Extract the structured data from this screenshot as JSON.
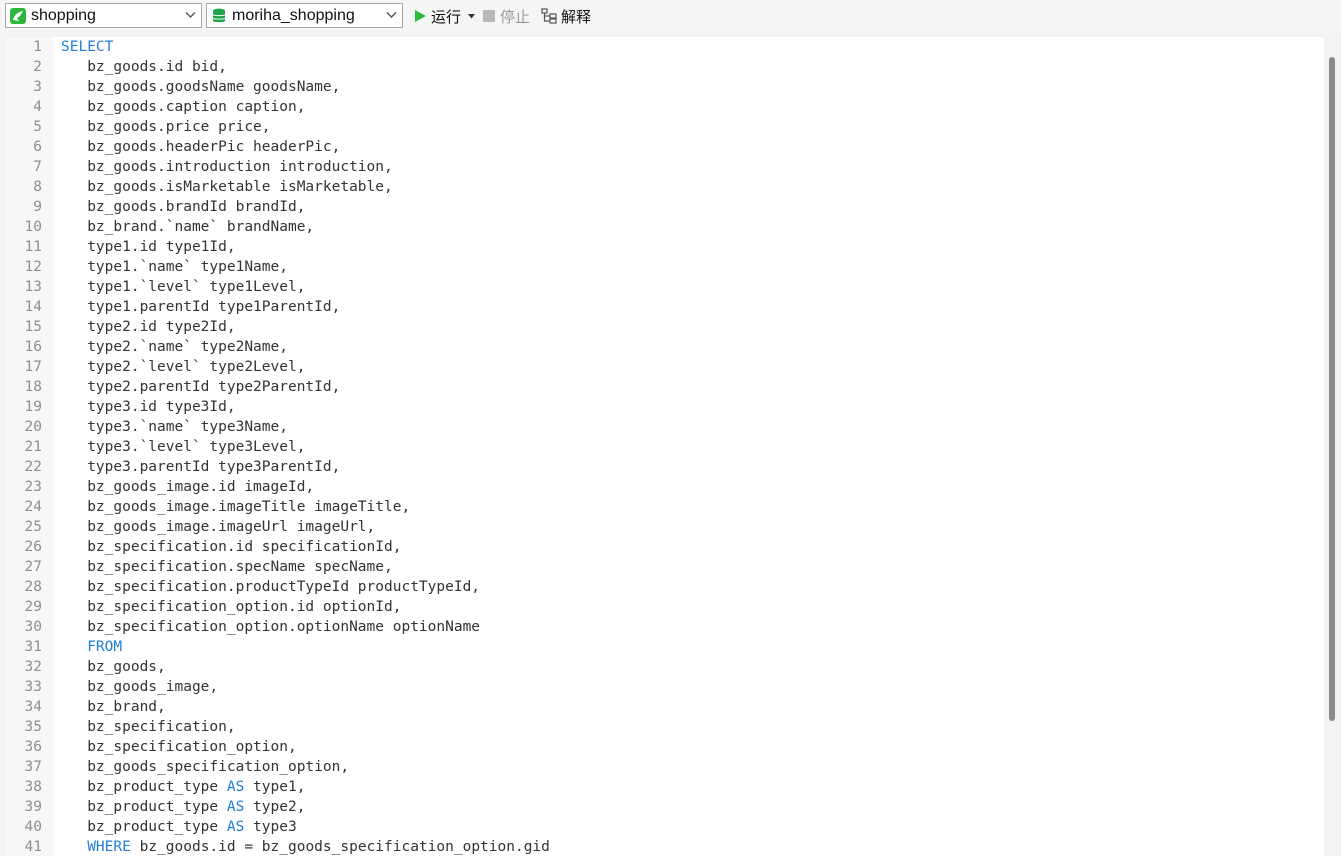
{
  "toolbar": {
    "connection": {
      "value": "shopping",
      "icon": "mysql-connection-icon"
    },
    "database": {
      "value": "moriha_shopping",
      "icon": "database-icon"
    },
    "run_label": "运行",
    "stop_label": "停止",
    "explain_label": "解释"
  },
  "colors": {
    "keyword": "#1f7fd8",
    "code_text": "#333333",
    "line_number": "#8e8e8e",
    "run_green": "#2db83d",
    "db_green": "#1fa34a"
  },
  "editor": {
    "language": "sql",
    "lines": [
      {
        "n": "1",
        "parts": [
          [
            "kw",
            "SELECT"
          ]
        ]
      },
      {
        "n": "2",
        "parts": [
          [
            "t",
            "   bz_goods.id bid,"
          ]
        ]
      },
      {
        "n": "3",
        "parts": [
          [
            "t",
            "   bz_goods.goodsName goodsName,"
          ]
        ]
      },
      {
        "n": "4",
        "parts": [
          [
            "t",
            "   bz_goods.caption caption,"
          ]
        ]
      },
      {
        "n": "5",
        "parts": [
          [
            "t",
            "   bz_goods.price price,"
          ]
        ]
      },
      {
        "n": "6",
        "parts": [
          [
            "t",
            "   bz_goods.headerPic headerPic,"
          ]
        ]
      },
      {
        "n": "7",
        "parts": [
          [
            "t",
            "   bz_goods.introduction introduction,"
          ]
        ]
      },
      {
        "n": "8",
        "parts": [
          [
            "t",
            "   bz_goods.isMarketable isMarketable,"
          ]
        ]
      },
      {
        "n": "9",
        "parts": [
          [
            "t",
            "   bz_goods.brandId brandId,"
          ]
        ]
      },
      {
        "n": "10",
        "parts": [
          [
            "t",
            "   bz_brand.`name` brandName,"
          ]
        ]
      },
      {
        "n": "11",
        "parts": [
          [
            "t",
            "   type1.id type1Id,"
          ]
        ]
      },
      {
        "n": "12",
        "parts": [
          [
            "t",
            "   type1.`name` type1Name,"
          ]
        ]
      },
      {
        "n": "13",
        "parts": [
          [
            "t",
            "   type1.`level` type1Level,"
          ]
        ]
      },
      {
        "n": "14",
        "parts": [
          [
            "t",
            "   type1.parentId type1ParentId,"
          ]
        ]
      },
      {
        "n": "15",
        "parts": [
          [
            "t",
            "   type2.id type2Id,"
          ]
        ]
      },
      {
        "n": "16",
        "parts": [
          [
            "t",
            "   type2.`name` type2Name,"
          ]
        ]
      },
      {
        "n": "17",
        "parts": [
          [
            "t",
            "   type2.`level` type2Level,"
          ]
        ]
      },
      {
        "n": "18",
        "parts": [
          [
            "t",
            "   type2.parentId type2ParentId,"
          ]
        ]
      },
      {
        "n": "19",
        "parts": [
          [
            "t",
            "   type3.id type3Id,"
          ]
        ]
      },
      {
        "n": "20",
        "parts": [
          [
            "t",
            "   type3.`name` type3Name,"
          ]
        ]
      },
      {
        "n": "21",
        "parts": [
          [
            "t",
            "   type3.`level` type3Level,"
          ]
        ]
      },
      {
        "n": "22",
        "parts": [
          [
            "t",
            "   type3.parentId type3ParentId,"
          ]
        ]
      },
      {
        "n": "23",
        "parts": [
          [
            "t",
            "   bz_goods_image.id imageId,"
          ]
        ]
      },
      {
        "n": "24",
        "parts": [
          [
            "t",
            "   bz_goods_image.imageTitle imageTitle,"
          ]
        ]
      },
      {
        "n": "25",
        "parts": [
          [
            "t",
            "   bz_goods_image.imageUrl imageUrl,"
          ]
        ]
      },
      {
        "n": "26",
        "parts": [
          [
            "t",
            "   bz_specification.id specificationId,"
          ]
        ]
      },
      {
        "n": "27",
        "parts": [
          [
            "t",
            "   bz_specification.specName specName,"
          ]
        ]
      },
      {
        "n": "28",
        "parts": [
          [
            "t",
            "   bz_specification.productTypeId productTypeId,"
          ]
        ]
      },
      {
        "n": "29",
        "parts": [
          [
            "t",
            "   bz_specification_option.id optionId,"
          ]
        ]
      },
      {
        "n": "30",
        "parts": [
          [
            "t",
            "   bz_specification_option.optionName optionName"
          ]
        ]
      },
      {
        "n": "31",
        "parts": [
          [
            "t",
            "   "
          ],
          [
            "kw",
            "FROM"
          ]
        ]
      },
      {
        "n": "32",
        "parts": [
          [
            "t",
            "   bz_goods,"
          ]
        ]
      },
      {
        "n": "33",
        "parts": [
          [
            "t",
            "   bz_goods_image,"
          ]
        ]
      },
      {
        "n": "34",
        "parts": [
          [
            "t",
            "   bz_brand,"
          ]
        ]
      },
      {
        "n": "35",
        "parts": [
          [
            "t",
            "   bz_specification,"
          ]
        ]
      },
      {
        "n": "36",
        "parts": [
          [
            "t",
            "   bz_specification_option,"
          ]
        ]
      },
      {
        "n": "37",
        "parts": [
          [
            "t",
            "   bz_goods_specification_option,"
          ]
        ]
      },
      {
        "n": "38",
        "parts": [
          [
            "t",
            "   bz_product_type "
          ],
          [
            "kw",
            "AS"
          ],
          [
            "t",
            " type1,"
          ]
        ]
      },
      {
        "n": "39",
        "parts": [
          [
            "t",
            "   bz_product_type "
          ],
          [
            "kw",
            "AS"
          ],
          [
            "t",
            " type2,"
          ]
        ]
      },
      {
        "n": "40",
        "parts": [
          [
            "t",
            "   bz_product_type "
          ],
          [
            "kw",
            "AS"
          ],
          [
            "t",
            " type3"
          ]
        ]
      },
      {
        "n": "41",
        "parts": [
          [
            "t",
            "   "
          ],
          [
            "kw",
            "WHERE"
          ],
          [
            "t",
            " bz_goods.id = bz_goods_specification_option.gid"
          ]
        ]
      }
    ]
  }
}
